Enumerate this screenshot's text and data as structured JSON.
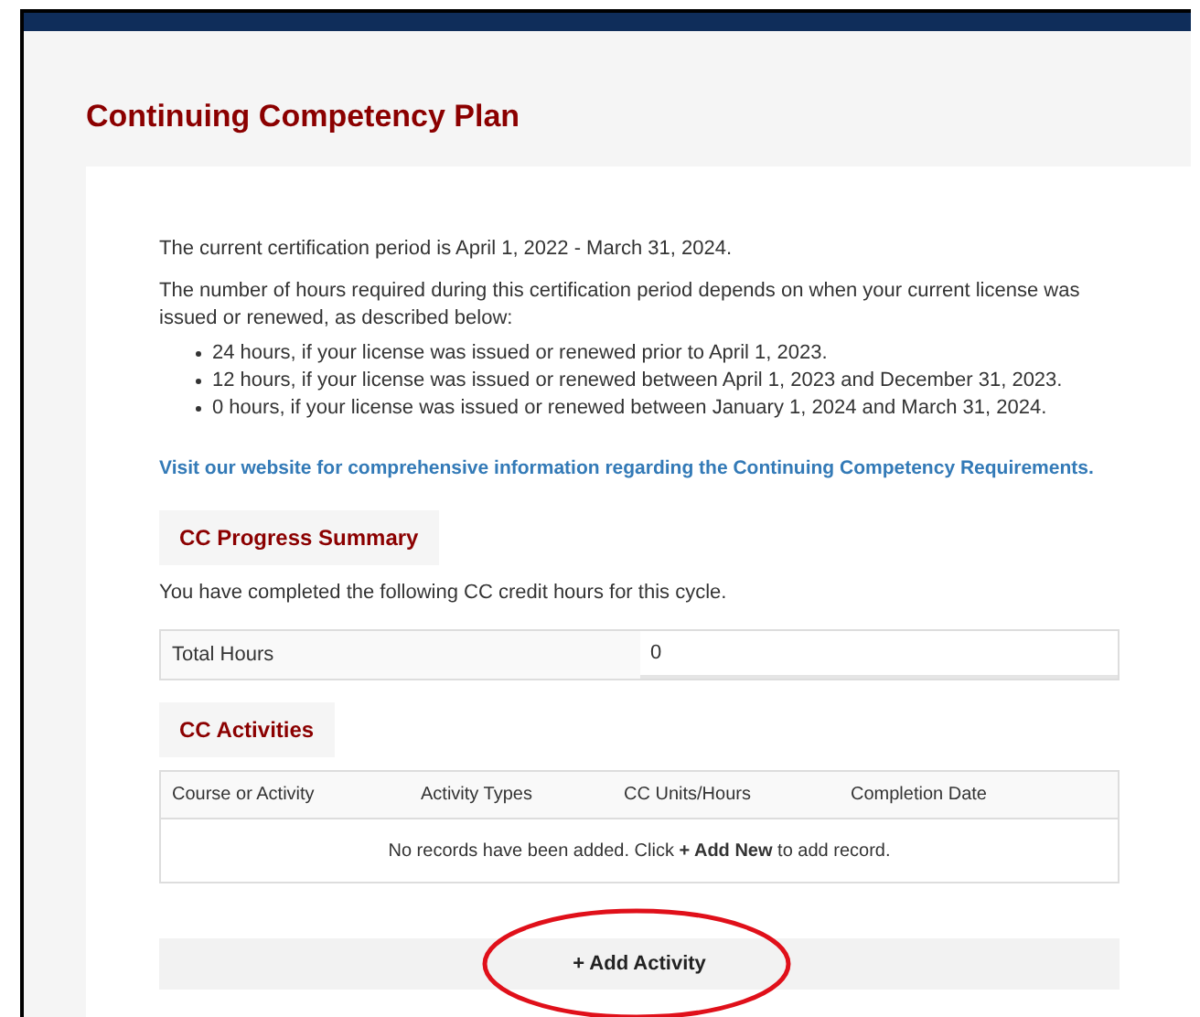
{
  "title": "Continuing Competency Plan",
  "intro": "The current certification period is April 1, 2022 - March 31, 2024.",
  "description": "The number of hours required during this certification period depends on when your current license was issued or renewed, as described below:",
  "requirements": [
    "24 hours, if your license was issued or renewed prior to April 1, 2023.",
    "12 hours, if your license was issued or renewed between April 1, 2023 and December 31, 2023.",
    "0 hours, if your license was issued or renewed between January 1, 2024 and March 31, 2024."
  ],
  "website_link": "Visit our website for comprehensive information regarding the Continuing Competency Requirements.",
  "progress_summary": {
    "heading": "CC Progress Summary",
    "text": "You have completed the following CC credit hours for this cycle.",
    "rows": [
      {
        "label": "Total Hours",
        "value": "0"
      }
    ]
  },
  "activities": {
    "heading": "CC Activities",
    "columns": [
      "Course or Activity",
      "Activity Types",
      "CC Units/Hours",
      "Completion Date"
    ],
    "empty_message": "No records have been added. Click **+ Add New** to add record."
  },
  "add_button": "+ Add Activity"
}
